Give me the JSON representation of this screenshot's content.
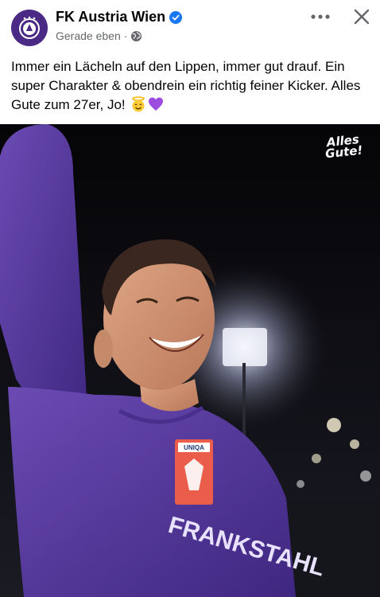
{
  "post": {
    "page_name": "FK Austria Wien",
    "timestamp": "Gerade eben",
    "separator": "·",
    "audience_icon": "globe-icon",
    "verified_icon": "verified-badge-icon",
    "caption": "Immer ein Lächeln auf den Lippen, immer gut drauf. Ein super Charakter & obendrein ein richtig feiner Kicker. Alles Gute zum 27er, Jo!",
    "caption_emojis": [
      "smiling-face-with-halo",
      "purple-heart"
    ],
    "actions": {
      "more_icon": "more-dots-icon",
      "close_icon": "close-icon"
    }
  },
  "image": {
    "sticker_line1": "Alles",
    "sticker_line2": "Gute!",
    "jersey_sponsor": "FRANKSTAHL",
    "chest_badge_text": "UNIQA"
  },
  "colors": {
    "brand_purple": "#4b2a86",
    "verified_blue": "#1877f2",
    "text_primary": "#050505",
    "text_secondary": "#65676b",
    "jersey_purple": "#5a3c9e"
  }
}
